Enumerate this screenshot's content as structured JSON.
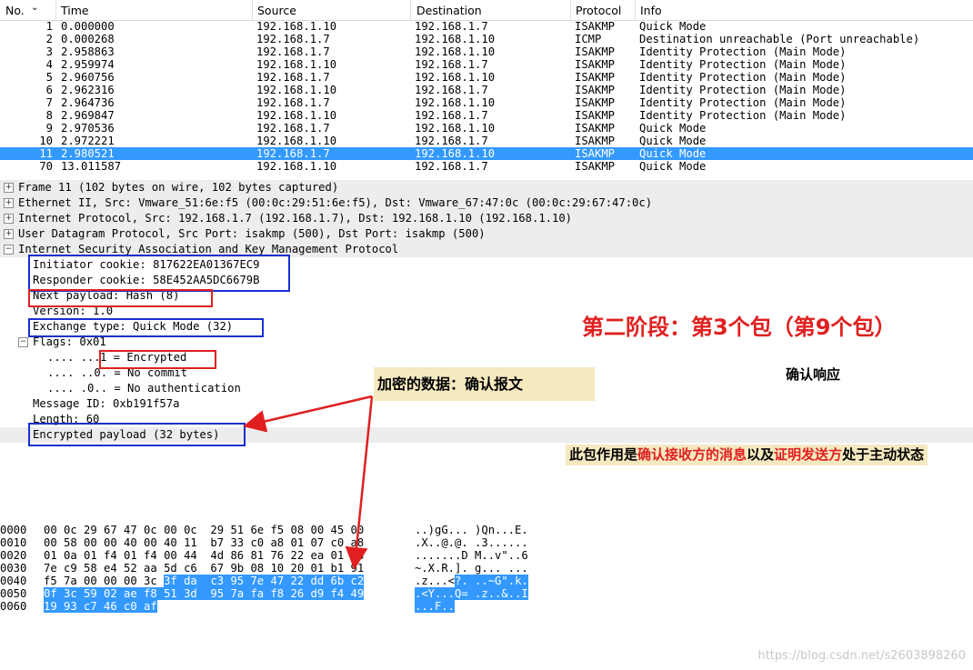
{
  "packet_list": {
    "columns": [
      "No.",
      "Time",
      "Source",
      "Destination",
      "Protocol",
      "Info"
    ],
    "rows": [
      {
        "no": "1",
        "time": "0.000000",
        "src": "192.168.1.10",
        "dst": "192.168.1.7",
        "proto": "ISAKMP",
        "info": "Quick Mode"
      },
      {
        "no": "2",
        "time": "0.000268",
        "src": "192.168.1.7",
        "dst": "192.168.1.10",
        "proto": "ICMP",
        "info": "Destination unreachable (Port unreachable)"
      },
      {
        "no": "3",
        "time": "2.958863",
        "src": "192.168.1.7",
        "dst": "192.168.1.10",
        "proto": "ISAKMP",
        "info": "Identity Protection (Main Mode)"
      },
      {
        "no": "4",
        "time": "2.959974",
        "src": "192.168.1.10",
        "dst": "192.168.1.7",
        "proto": "ISAKMP",
        "info": "Identity Protection (Main Mode)"
      },
      {
        "no": "5",
        "time": "2.960756",
        "src": "192.168.1.7",
        "dst": "192.168.1.10",
        "proto": "ISAKMP",
        "info": "Identity Protection (Main Mode)"
      },
      {
        "no": "6",
        "time": "2.962316",
        "src": "192.168.1.10",
        "dst": "192.168.1.7",
        "proto": "ISAKMP",
        "info": "Identity Protection (Main Mode)"
      },
      {
        "no": "7",
        "time": "2.964736",
        "src": "192.168.1.7",
        "dst": "192.168.1.10",
        "proto": "ISAKMP",
        "info": "Identity Protection (Main Mode)"
      },
      {
        "no": "8",
        "time": "2.969847",
        "src": "192.168.1.10",
        "dst": "192.168.1.7",
        "proto": "ISAKMP",
        "info": "Identity Protection (Main Mode)"
      },
      {
        "no": "9",
        "time": "2.970536",
        "src": "192.168.1.7",
        "dst": "192.168.1.10",
        "proto": "ISAKMP",
        "info": "Quick Mode"
      },
      {
        "no": "10",
        "time": "2.972221",
        "src": "192.168.1.10",
        "dst": "192.168.1.7",
        "proto": "ISAKMP",
        "info": "Quick Mode"
      },
      {
        "no": "11",
        "time": "2.980521",
        "src": "192.168.1.7",
        "dst": "192.168.1.10",
        "proto": "ISAKMP",
        "info": "Quick Mode"
      },
      {
        "no": "70",
        "time": "13.011587",
        "src": "192.168.1.10",
        "dst": "192.168.1.7",
        "proto": "ISAKMP",
        "info": "Quick Mode"
      }
    ],
    "selected_no": "11"
  },
  "details": {
    "frame": "Frame 11 (102 bytes on wire, 102 bytes captured)",
    "ethernet": "Ethernet II, Src: Vmware_51:6e:f5 (00:0c:29:51:6e:f5), Dst: Vmware_67:47:0c (00:0c:29:67:47:0c)",
    "ip": "Internet Protocol, Src: 192.168.1.7 (192.168.1.7), Dst: 192.168.1.10 (192.168.1.10)",
    "udp": "User Datagram Protocol, Src Port: isakmp (500), Dst Port: isakmp (500)",
    "isakmp": "Internet Security Association and Key Management Protocol",
    "initiator_cookie": "Initiator cookie: 817622EA01367EC9",
    "responder_cookie": "Responder cookie: 58E452AA5DC6679B",
    "next_payload": "Next payload: Hash (8)",
    "version": "Version: 1.0",
    "exchange_type": "Exchange type: Quick Mode (32)",
    "flags": "Flags: 0x01",
    "flag_encrypted_prefix": ".... ...",
    "flag_encrypted": "1 = Encrypted",
    "flag_commit": ".... ..0. = No commit",
    "flag_auth": ".... .0.. = No authentication",
    "message_id": "Message ID: 0xb191f57a",
    "length": "Length: 60",
    "encrypted_payload": "Encrypted payload (32 bytes)"
  },
  "hex": {
    "rows": [
      {
        "off": "0000",
        "bytes_plain": "00 0c 29 67 47 0c 00 0c  29 51 6e f5 08 00 45 00",
        "bytes_sel": "",
        "ascii_plain": "..)gG... )Qn...E.",
        "ascii_sel": ""
      },
      {
        "off": "0010",
        "bytes_plain": "00 58 00 00 40 00 40 11  b7 33 c0 a8 01 07 c0 a8",
        "bytes_sel": "",
        "ascii_plain": ".X..@.@. .3......",
        "ascii_sel": ""
      },
      {
        "off": "0020",
        "bytes_plain": "01 0a 01 f4 01 f4 00 44  4d 86 81 76 22 ea 01 36",
        "bytes_sel": "",
        "ascii_plain": ".......D M..v\"..6",
        "ascii_sel": ""
      },
      {
        "off": "0030",
        "bytes_plain": "7e c9 58 e4 52 aa 5d c6  67 9b 08 10 20 01 b1 91",
        "bytes_sel": "",
        "ascii_plain": "~.X.R.]. g... ...",
        "ascii_sel": ""
      },
      {
        "off": "0040",
        "bytes_plain": "f5 7a 00 00 00 3c ",
        "bytes_sel": "3f da  c3 95 7e 47 22 dd 6b c2",
        "ascii_plain": ".z...<",
        "ascii_sel": "?. ..~G\".k."
      },
      {
        "off": "0050",
        "bytes_plain": "",
        "bytes_sel": "0f 3c 59 02 ae f8 51 3d  95 7a fa f8 26 d9 f4 49",
        "ascii_plain": "",
        "ascii_sel": ".<Y...Q= .z..&..I"
      },
      {
        "off": "0060",
        "bytes_plain": "",
        "bytes_sel": "19 93 c7 46 c0 af",
        "ascii_plain": "",
        "ascii_sel": "...F.."
      }
    ]
  },
  "annotations": {
    "phase_title": "第二阶段：第3个包（第9个包）",
    "confirm_response": "确认响应",
    "encrypted_data": "加密的数据：确认报文",
    "purpose_pre": "此包作用是",
    "purpose_red1": "确认接收方的消息",
    "purpose_mid": "以及",
    "purpose_red2": "证明发送方",
    "purpose_post": "处于主动状态"
  },
  "watermark": "https://blog.csdn.net/s2603898260",
  "colors": {
    "selection": "#3399ff",
    "red": "#e02020",
    "blue": "#1a2fd0",
    "note_bg": "#f5e9c0"
  }
}
